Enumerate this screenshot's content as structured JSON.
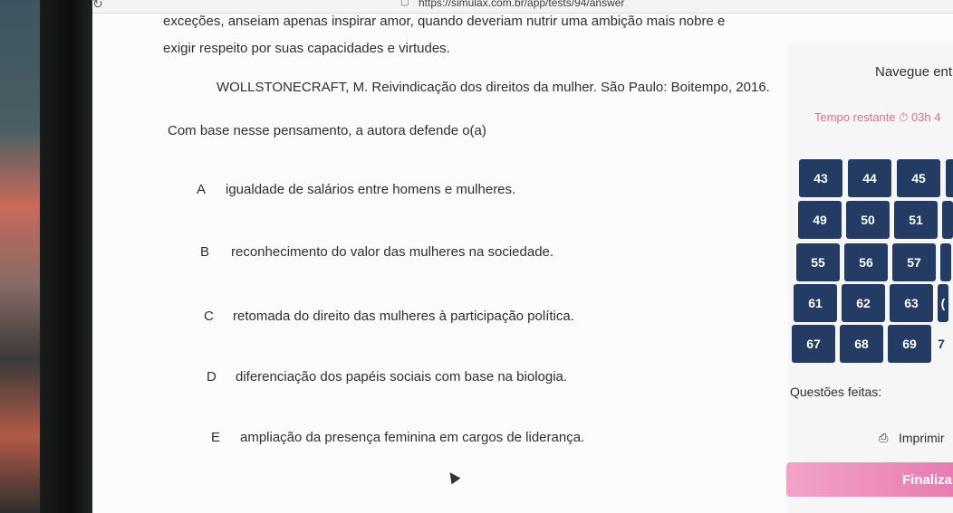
{
  "browser": {
    "url": "https://simulax.com.br/app/tests/94/answer"
  },
  "question": {
    "text_line1": "exceções, anseiam apenas inspirar amor, quando deveriam nutrir uma ambição mais nobre e",
    "text_line2": "exigir respeito por suas capacidades e virtudes.",
    "reference": "WOLLSTONECRAFT, M. Reivindicação dos direitos da mulher. São Paulo: Boitempo, 2016.",
    "prompt": "Com base nesse pensamento, a autora defende o(a)"
  },
  "options": [
    {
      "letter": "A",
      "text": "igualdade de salários entre homens e mulheres."
    },
    {
      "letter": "B",
      "text": "reconhecimento do valor das mulheres na sociedade."
    },
    {
      "letter": "C",
      "text": "retomada do direito das mulheres à participação política."
    },
    {
      "letter": "D",
      "text": "diferenciação dos papéis sociais com base na biologia."
    },
    {
      "letter": "E",
      "text": "ampliação da presença feminina em cargos de liderança."
    }
  ],
  "sidebar": {
    "nav_title": "Navegue ent",
    "timer": "Tempo restante ⏱ 03h 4",
    "question_numbers": [
      [
        "43",
        "44",
        "45",
        ""
      ],
      [
        "49",
        "50",
        "51",
        ""
      ],
      [
        "55",
        "56",
        "57",
        ""
      ],
      [
        "61",
        "62",
        "63",
        "("
      ],
      [
        "67",
        "68",
        "69",
        "7"
      ]
    ],
    "answered_label": "Questões feitas:",
    "print_label": "Imprimir",
    "print_icon": "printer-icon",
    "finish_label": "Finalizar"
  }
}
